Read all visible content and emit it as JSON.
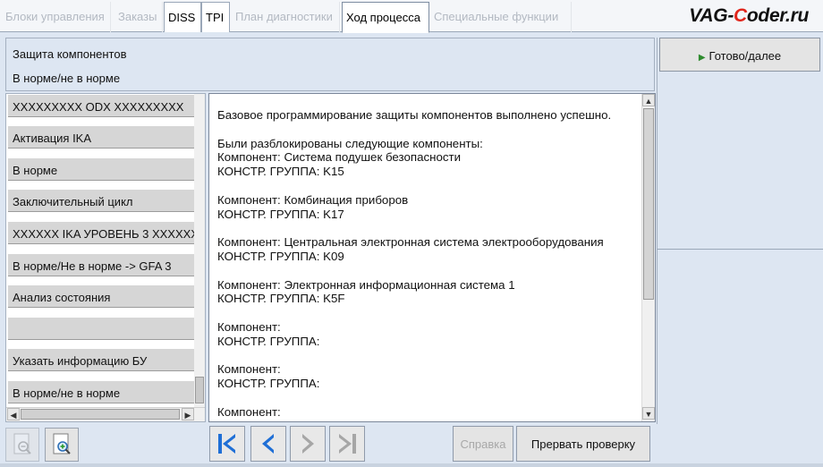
{
  "tabs": [
    {
      "label": "Блоки управления",
      "state": "disabled"
    },
    {
      "label": "Заказы",
      "state": "disabled"
    },
    {
      "label": "DISS",
      "state": "enabled"
    },
    {
      "label": "TPI",
      "state": "enabled"
    },
    {
      "label": "План диагностики",
      "state": "disabled"
    },
    {
      "label": "Ход процесса",
      "state": "active"
    },
    {
      "label": "Специальные функции",
      "state": "disabled"
    }
  ],
  "watermark": {
    "prefix": "VAG-",
    "highlight": "C",
    "suffix": "oder.ru"
  },
  "header": {
    "title": "Защита компонентов",
    "status": "В норме/не в норме"
  },
  "steps": [
    "XXXXXXXXX ODX XXXXXXXXX",
    "Активация IKA",
    "В норме",
    "Заключительный цикл",
    "XXXXXX IKA УРОВЕНЬ 3 XXXXXX",
    "В норме/Не в норме -> GFA 3",
    "Анализ состояния",
    "",
    "Указать информацию БУ",
    "В норме/не в норме"
  ],
  "message": {
    "text": "Базовое программирование защиты компонентов выполнено успешно.\n\nБыли разблокированы следующие компоненты:\nКомпонент: Система подушек безопасности\nКОНСТР. ГРУППА: K15\n\nКомпонент: Комбинация приборов\nКОНСТР. ГРУППА: K17\n\nКомпонент: Центральная электронная система электрооборудования\nКОНСТР. ГРУППА: K09\n\nКомпонент: Электронная информационная система 1\nКОНСТР. ГРУППА: K5F\n\nКомпонент:\nКОНСТР. ГРУППА:\n\nКомпонент:\nКОНСТР. ГРУППА:\n\nКомпонент:\nКОНСТР. ГРУППА:"
  },
  "right_panel": {
    "next_label": "Готово/далее",
    "next_icon": "play-icon"
  },
  "toolbar": {
    "zoom_out_icon": "zoom-out-icon",
    "zoom_in_icon": "zoom-in-icon",
    "nav_icons": [
      "first-icon",
      "back-icon",
      "forward-icon",
      "last-icon"
    ],
    "help_label": "Справка",
    "cancel_label": "Прервать проверку"
  },
  "colors": {
    "panel_bg": "#dde6f2",
    "nav_blue": "#1f6fd6",
    "nav_disabled": "#a6a6a6",
    "play_green": "#2e8b2e",
    "brand_red": "#e0261c"
  }
}
